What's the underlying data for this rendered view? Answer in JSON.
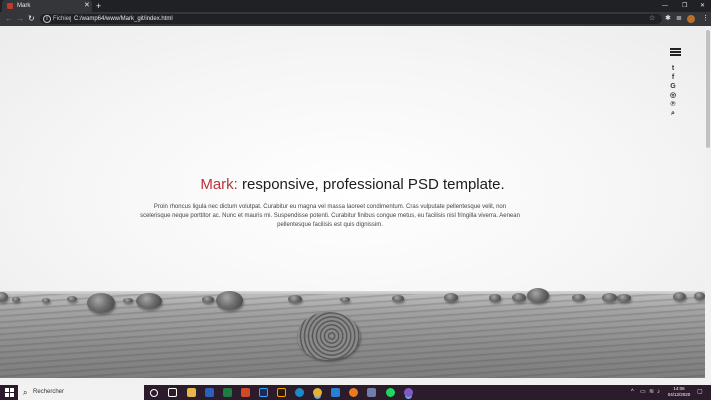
{
  "browser": {
    "tab_title": "Mark",
    "tab_close": "✕",
    "new_tab": "+",
    "window_minimize": "—",
    "window_maximize": "❐",
    "window_close": "✕",
    "back": "←",
    "forward": "→",
    "reload": "↻",
    "info_icon": "i",
    "site_label": "Fichier",
    "url": "C:/wamp64/www/Mark_git/index.html",
    "star": "☆",
    "menu": "⋮"
  },
  "page": {
    "brand": "Mark:",
    "headline": " responsive, professional PSD template.",
    "paragraph": "Proin rhoncus ligula nec dictum volutpat. Curabitur eu magna vel massa laoreet condimentum. Cras vulputate pellentesque velit, non scelerisque neque porttitor ac. Nunc et mauris mi. Suspendisse potenti. Curabitur finibus congue metus, eu facilisis nisl fringilla viverra. Aenean pellentesque facilisis est quis dignissim.",
    "brand_color": "#b8343b",
    "social_icons": [
      {
        "name": "twitter-icon",
        "glyph": "t"
      },
      {
        "name": "facebook-icon",
        "glyph": "f"
      },
      {
        "name": "google-icon",
        "glyph": "G"
      },
      {
        "name": "instagram-icon",
        "glyph": "◎"
      },
      {
        "name": "pinterest-icon",
        "glyph": "℗"
      },
      {
        "name": "search-icon",
        "glyph": "⌕"
      }
    ]
  },
  "taskbar": {
    "search_placeholder": "Rechercher",
    "time": "14:06",
    "date": "04/12/2020",
    "tray_chevron": "^"
  }
}
